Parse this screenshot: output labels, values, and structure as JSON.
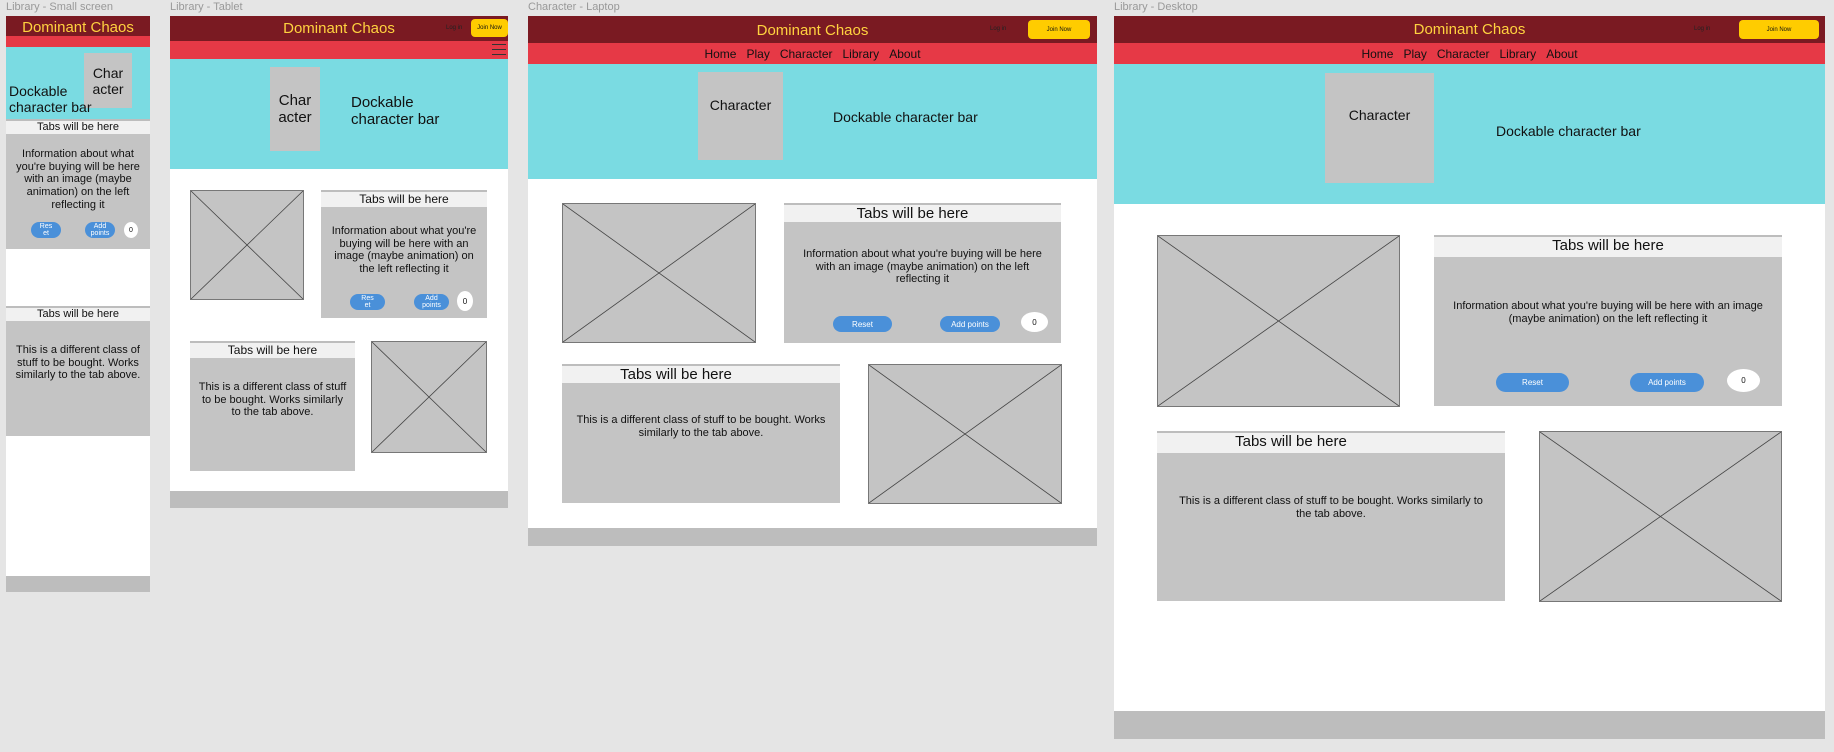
{
  "frames": {
    "small": {
      "label": "Library - Small screen"
    },
    "tablet": {
      "label": "Library - Tablet"
    },
    "laptop": {
      "label": "Character - Laptop"
    },
    "desktop": {
      "label": "Library - Desktop"
    }
  },
  "site": {
    "brand": "Dominant Chaos",
    "login": "Log in",
    "join": "Join Now",
    "nav": [
      "Home",
      "Play",
      "Character",
      "Library",
      "About"
    ]
  },
  "hero": {
    "character": "Character",
    "character_small": "Char\nacter",
    "dock": "Dockable character bar",
    "dock_small": "Dockable\ncharacter bar",
    "dock_tablet": "Dockable\ncharacter bar"
  },
  "cards": {
    "tabs": "Tabs will be here",
    "info": "Information about what you're buying will be here with an image (maybe animation) on the left reflecting it",
    "different": "This is a different class of stuff to be bought. Works similarly to the tab above.",
    "reset": "Reset",
    "reset_small": "Res\net",
    "add_points": "Add points",
    "add_points_small": "Add\npoints",
    "counter": "0"
  },
  "colors": {
    "header": "#7a1a22",
    "brand": "#ffd23f",
    "nav": "#e63946",
    "hero": "#7adbe2",
    "join": "#ffcc00",
    "button": "#4a90d9",
    "placeholder": "#c4c4c4"
  },
  "icons": {
    "placeholder": "image-placeholder-icon",
    "menu": "menu-icon"
  }
}
